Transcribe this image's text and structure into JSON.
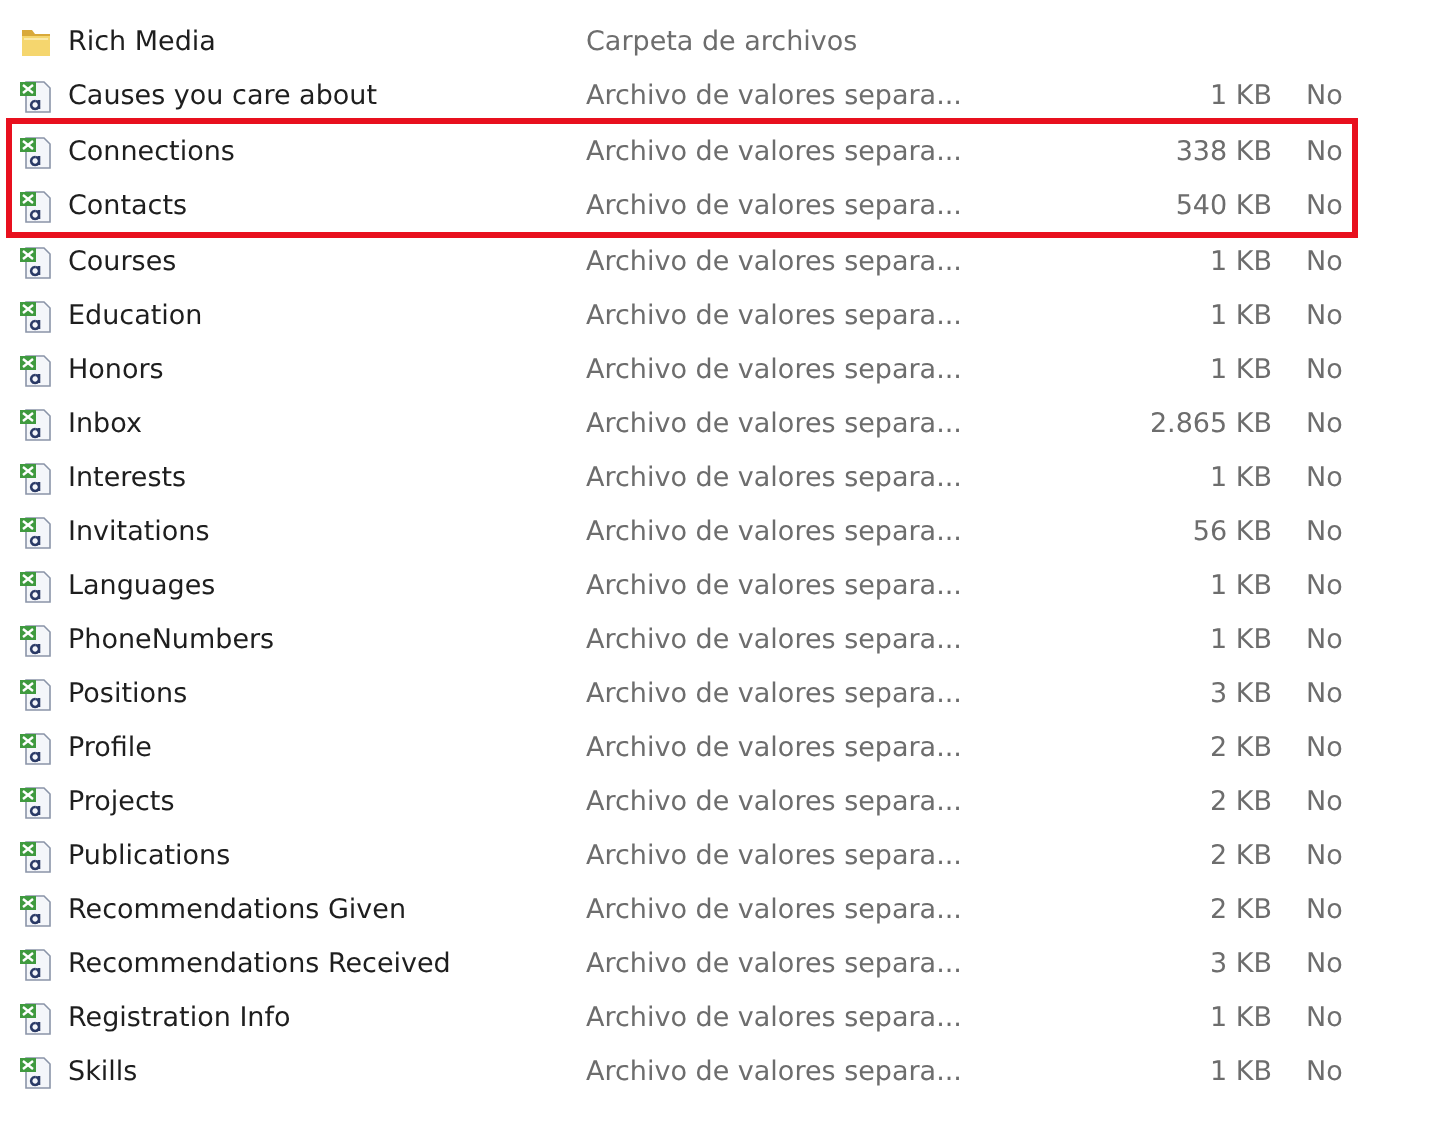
{
  "files": [
    {
      "kind": "folder",
      "name": "Rich Media",
      "type": "Carpeta de archivos",
      "highlighted": false
    },
    {
      "kind": "csv",
      "name": "Causes you care about",
      "type": "Archivo de valores separa...",
      "size": "1 KB",
      "column_4": "No",
      "highlighted": false
    },
    {
      "kind": "csv",
      "name": "Connections",
      "type": "Archivo de valores separa...",
      "size": "338 KB",
      "column_4": "No",
      "highlighted": true
    },
    {
      "kind": "csv",
      "name": "Contacts",
      "type": "Archivo de valores separa...",
      "size": "540 KB",
      "column_4": "No",
      "highlighted": true
    },
    {
      "kind": "csv",
      "name": "Courses",
      "type": "Archivo de valores separa...",
      "size": "1 KB",
      "column_4": "No",
      "highlighted": false
    },
    {
      "kind": "csv",
      "name": "Education",
      "type": "Archivo de valores separa...",
      "size": "1 KB",
      "column_4": "No",
      "highlighted": false
    },
    {
      "kind": "csv",
      "name": "Honors",
      "type": "Archivo de valores separa...",
      "size": "1 KB",
      "column_4": "No",
      "highlighted": false
    },
    {
      "kind": "csv",
      "name": "Inbox",
      "type": "Archivo de valores separa...",
      "size": "2.865 KB",
      "column_4": "No",
      "highlighted": false
    },
    {
      "kind": "csv",
      "name": "Interests",
      "type": "Archivo de valores separa...",
      "size": "1 KB",
      "column_4": "No",
      "highlighted": false
    },
    {
      "kind": "csv",
      "name": "Invitations",
      "type": "Archivo de valores separa...",
      "size": "56 KB",
      "column_4": "No",
      "highlighted": false
    },
    {
      "kind": "csv",
      "name": "Languages",
      "type": "Archivo de valores separa...",
      "size": "1 KB",
      "column_4": "No",
      "highlighted": false
    },
    {
      "kind": "csv",
      "name": "PhoneNumbers",
      "type": "Archivo de valores separa...",
      "size": "1 KB",
      "column_4": "No",
      "highlighted": false
    },
    {
      "kind": "csv",
      "name": "Positions",
      "type": "Archivo de valores separa...",
      "size": "3 KB",
      "column_4": "No",
      "highlighted": false
    },
    {
      "kind": "csv",
      "name": "Profile",
      "type": "Archivo de valores separa...",
      "size": "2 KB",
      "column_4": "No",
      "highlighted": false
    },
    {
      "kind": "csv",
      "name": "Projects",
      "type": "Archivo de valores separa...",
      "size": "2 KB",
      "column_4": "No",
      "highlighted": false
    },
    {
      "kind": "csv",
      "name": "Publications",
      "type": "Archivo de valores separa...",
      "size": "2 KB",
      "column_4": "No",
      "highlighted": false
    },
    {
      "kind": "csv",
      "name": "Recommendations Given",
      "type": "Archivo de valores separa...",
      "size": "2 KB",
      "column_4": "No",
      "highlighted": false
    },
    {
      "kind": "csv",
      "name": "Recommendations Received",
      "type": "Archivo de valores separa...",
      "size": "3 KB",
      "column_4": "No",
      "highlighted": false
    },
    {
      "kind": "csv",
      "name": "Registration Info",
      "type": "Archivo de valores separa...",
      "size": "1 KB",
      "column_4": "No",
      "highlighted": false
    },
    {
      "kind": "csv",
      "name": "Skills",
      "type": "Archivo de valores separa...",
      "size": "1 KB",
      "column_4": "No",
      "highlighted": false
    }
  ]
}
